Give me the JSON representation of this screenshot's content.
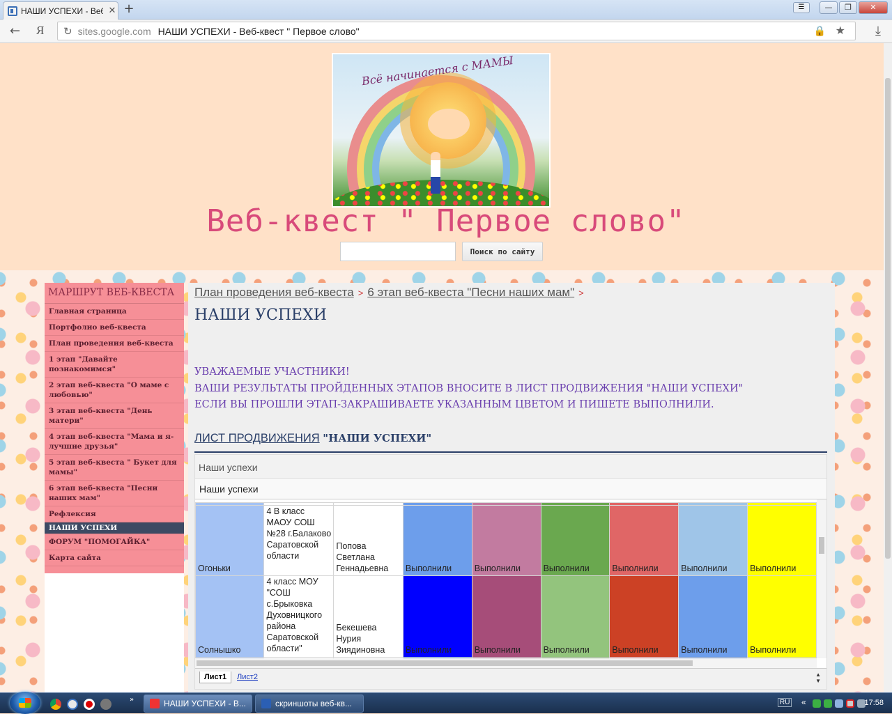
{
  "browser": {
    "tab_title": "НАШИ УСПЕХИ - Веб",
    "tab_close": "✕",
    "new_tab": "+",
    "back_glyph": "←",
    "ya_glyph": "Я",
    "reload_glyph": "↻",
    "url_host": "sites.google.com",
    "url_title": "НАШИ УСПЕХИ - Веб-квест \" Первое слово\"",
    "lock_glyph": "🔒",
    "star_glyph": "★",
    "download_glyph": "⤓",
    "menu_glyph": "☰",
    "min_glyph": "—",
    "max_glyph": "❐",
    "close_glyph": "✕"
  },
  "banner": {
    "arc_text": "Всё начинается с МАМЫ"
  },
  "site": {
    "title": "Веб-квест \" Первое слово\"",
    "search_button": "Поиск по сайту",
    "search_value": ""
  },
  "sidebar": {
    "heading": "МАРШРУТ ВЕБ-КВЕСТА",
    "items": [
      "Главная страница",
      "Портфолио веб-квеста",
      "План проведения веб-квеста",
      "1 этап \"Давайте познакомимся\"",
      "2 этап веб-квеста \"О маме с любовью\"",
      "3 этап веб-квеста \"День матери\"",
      "4 этап веб-квеста \"Мама и я-лучшие друзья\"",
      "5 этап веб-квеста \" Букет для мамы\"",
      "6 этап веб-квеста \"Песни наших мам\"",
      "Рефлексия",
      "НАШИ УСПЕХИ",
      "ФОРУМ \"ПОМОГАЙКА\"",
      "Карта сайта"
    ]
  },
  "breadcrumb": {
    "crumb1": "План проведения веб-квеста",
    "crumb2": "6 этап веб-квеста \"Песни наших мам\"",
    "sep": ">"
  },
  "main": {
    "page_title": "НАШИ УСПЕХИ",
    "intro_line1": "УВАЖАЕМЫЕ УЧАСТНИКИ!",
    "intro_line2": "ВАШИ РЕЗУЛЬТАТЫ ПРОЙДЕННЫХ ЭТАПОВ ВНОСИТЕ В ЛИСТ ПРОДВИЖЕНИЯ \"НАШИ УСПЕХИ\"",
    "intro_line3": "ЕСЛИ ВЫ ПРОШЛИ ЭТАП-ЗАКРАШИВАЕТЕ УКАЗАННЫМ ЦВЕТОМ И ПИШЕТЕ ВЫПОЛНИЛИ.",
    "sheet_link": "ЛИСТ ПРОДВИЖЕНИЯ",
    "sheet_bold": "\"НАШИ УСПЕХИ\""
  },
  "sheet": {
    "title1": "Наши успехи",
    "title2": "Наши успехи",
    "rows": [
      {
        "team": "Огоньки",
        "team_color": "#a4c2f4",
        "school": "4 В класс МАОУ СОШ №28 г.Балаково Саратовской области",
        "teacher": "Попова Светлана Геннадьевна",
        "stages": [
          {
            "text": "Выполнили",
            "color": "#6d9eeb"
          },
          {
            "text": "Выполнили",
            "color": "#c27ba0"
          },
          {
            "text": "Выполнили",
            "color": "#6aa84f"
          },
          {
            "text": "Выполнили",
            "color": "#e06666"
          },
          {
            "text": "Выполнили",
            "color": "#9fc5e8"
          },
          {
            "text": "Выполнили",
            "color": "#ffff00"
          }
        ]
      },
      {
        "team": "Солнышко",
        "team_color": "#a4c2f4",
        "school": "4 класс МОУ \"СОШ с.Брыковка Духовницкого района Саратовской области\"",
        "teacher": "Бекешева Нурия Зиядиновна",
        "stages": [
          {
            "text": "Выполнили",
            "color": "#0000ff"
          },
          {
            "text": "Выполнили",
            "color": "#a64d79"
          },
          {
            "text": "Выполнили",
            "color": "#93c47d"
          },
          {
            "text": "Выполнили",
            "color": "#cc4125"
          },
          {
            "text": "Выполнили",
            "color": "#6d9eeb"
          },
          {
            "text": "Выполнили",
            "color": "#ffff00"
          }
        ]
      }
    ],
    "tab_active": "Лист1",
    "tab_inactive": "Лист2",
    "arrows_up": "▲",
    "arrows_down": "▼"
  },
  "taskbar": {
    "btn1": "НАШИ УСПЕХИ - В...",
    "btn2": "скриншоты веб-кв...",
    "lang": "RU",
    "time": "17:58",
    "chevron": "«",
    "tray_more": "»"
  }
}
